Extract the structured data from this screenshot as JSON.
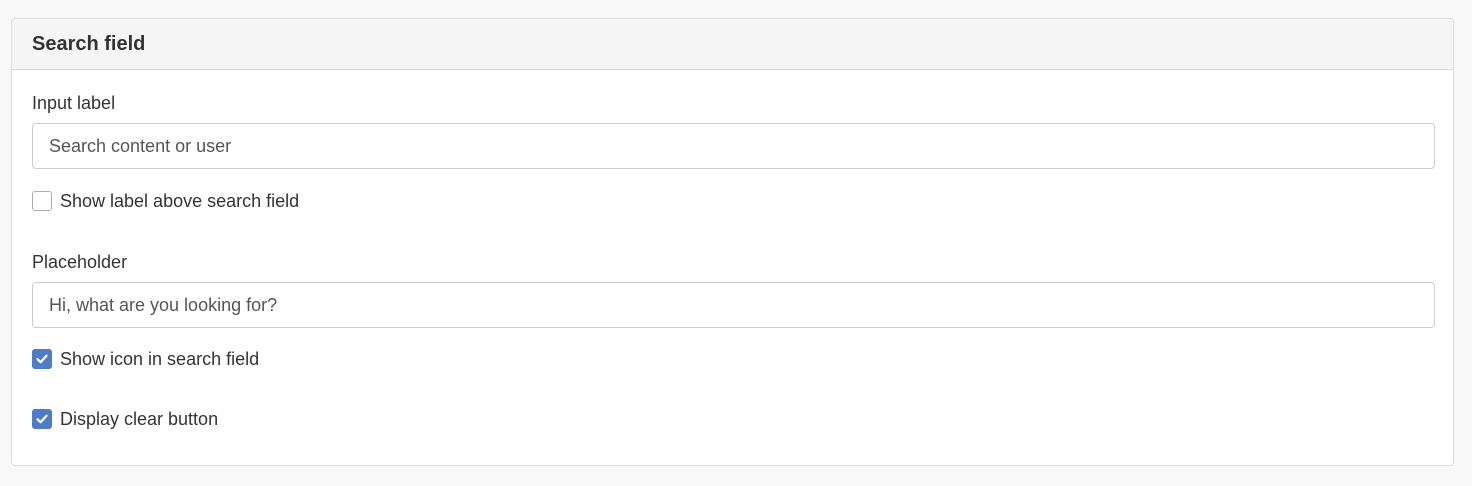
{
  "panel": {
    "title": "Search field"
  },
  "input_label": {
    "label": "Input label",
    "value": "Search content or user"
  },
  "show_label_checkbox": {
    "label": "Show label above search field",
    "checked": false
  },
  "placeholder_field": {
    "label": "Placeholder",
    "value": "Hi, what are you looking for?"
  },
  "show_icon_checkbox": {
    "label": "Show icon in search field",
    "checked": true
  },
  "clear_button_checkbox": {
    "label": "Display clear button",
    "checked": true
  },
  "colors": {
    "checkbox_checked": "#4d7cc9",
    "panel_heading_bg": "#f5f5f5"
  }
}
